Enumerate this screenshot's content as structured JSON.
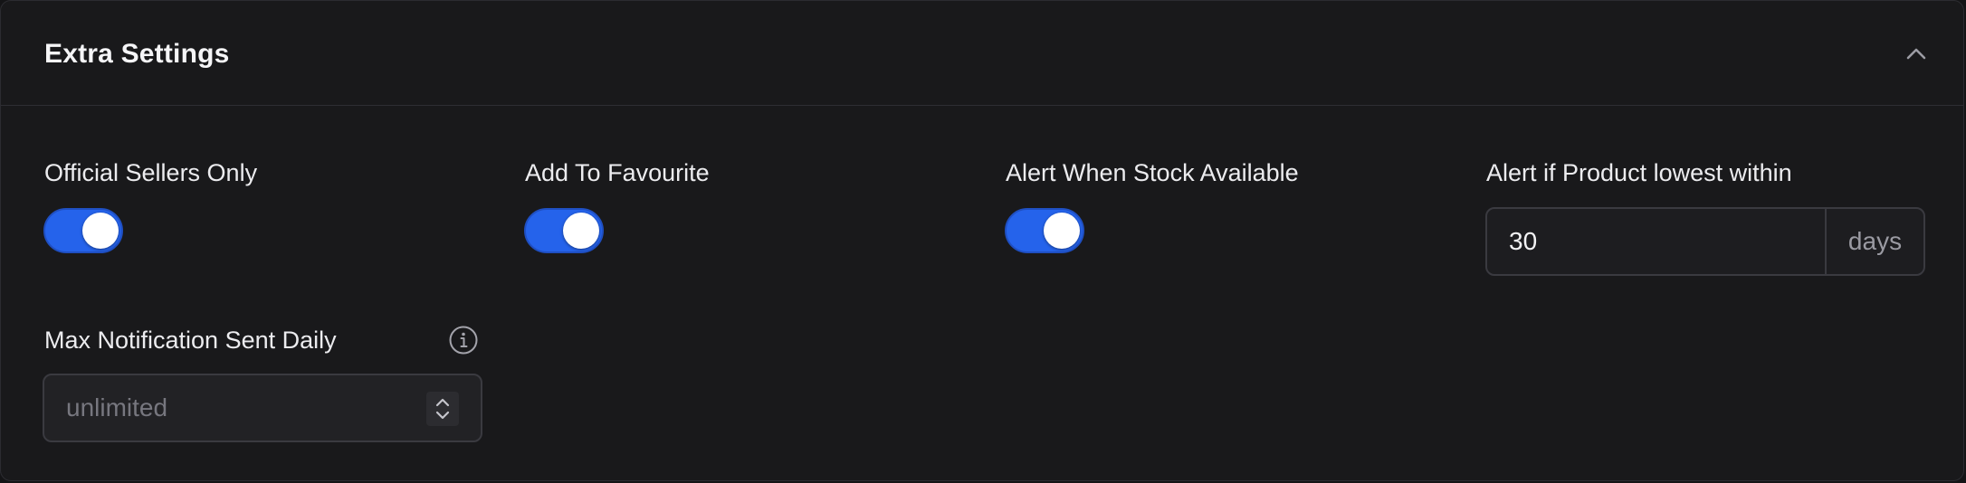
{
  "header": {
    "title": "Extra Settings",
    "collapse_icon": "chevron-up-icon"
  },
  "settings": {
    "official_sellers": {
      "label": "Official Sellers Only",
      "enabled": true
    },
    "add_favourite": {
      "label": "Add To Favourite",
      "enabled": true
    },
    "stock_alert": {
      "label": "Alert When Stock Available",
      "enabled": true
    },
    "lowest_within": {
      "label": "Alert if Product lowest within",
      "value": "30",
      "suffix": "days"
    },
    "max_notifications": {
      "label": "Max Notification Sent Daily",
      "placeholder": "unlimited",
      "info_icon": "info-icon",
      "stepper_icon": "chevron-up-down-icon"
    }
  },
  "colors": {
    "background": "#19191b",
    "toggle_on": "#2563eb",
    "border": "#3a3a40"
  }
}
